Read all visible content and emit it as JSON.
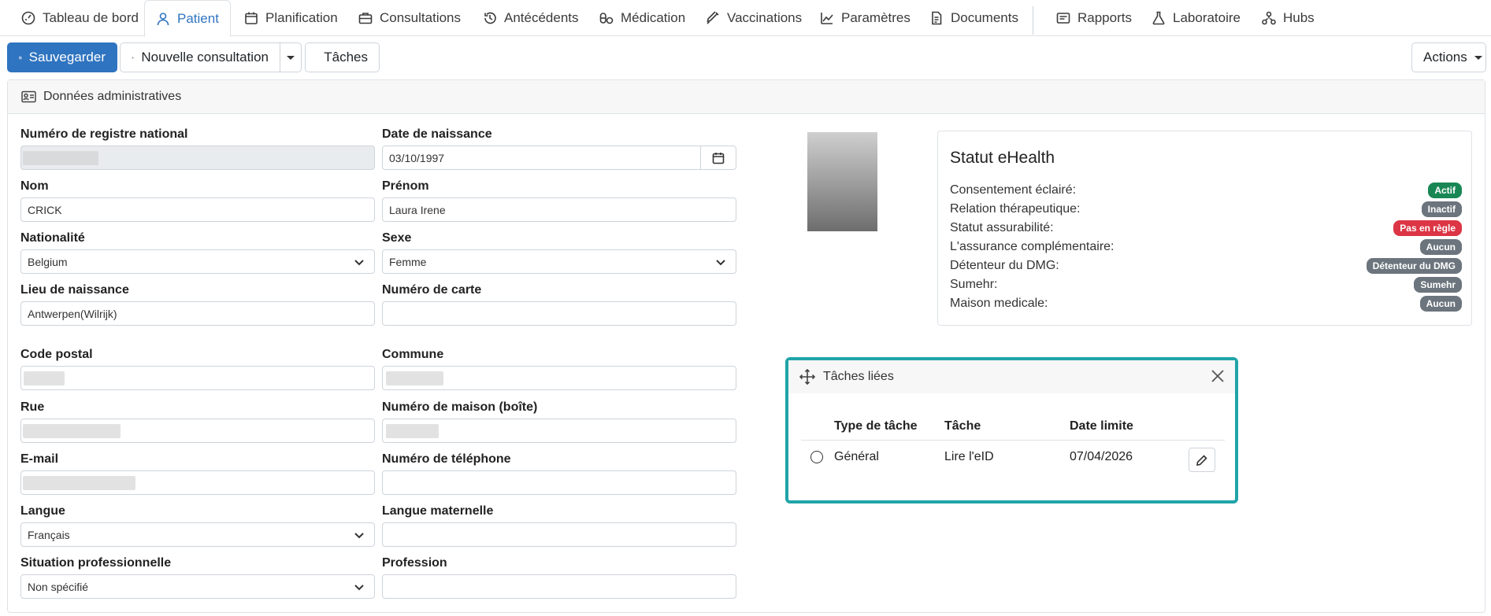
{
  "nav": {
    "items": [
      {
        "label": "Tableau de bord",
        "icon": "dashboard-icon"
      },
      {
        "label": "Patient",
        "icon": "person-icon",
        "active": true
      },
      {
        "label": "Planification",
        "icon": "calendar-icon"
      },
      {
        "label": "Consultations",
        "icon": "briefcase-icon"
      },
      {
        "label": "Antécédents",
        "icon": "history-icon"
      },
      {
        "label": "Médication",
        "icon": "pills-icon"
      },
      {
        "label": "Vaccinations",
        "icon": "syringe-icon"
      },
      {
        "label": "Paramètres",
        "icon": "chart-icon"
      },
      {
        "label": "Documents",
        "icon": "document-icon"
      },
      {
        "label": "Rapports",
        "icon": "report-icon"
      },
      {
        "label": "Laboratoire",
        "icon": "flask-icon"
      },
      {
        "label": "Hubs",
        "icon": "hubs-icon"
      }
    ]
  },
  "toolbar": {
    "save": "Sauvegarder",
    "new_consultation": "Nouvelle consultation",
    "tasks": "Tâches",
    "actions": "Actions"
  },
  "card": {
    "title": "Données administratives"
  },
  "form": {
    "national_number": {
      "label": "Numéro de registre national",
      "value": ""
    },
    "birth_date": {
      "label": "Date de naissance",
      "value": "03/10/1997"
    },
    "last_name": {
      "label": "Nom",
      "value": "CRICK"
    },
    "first_name": {
      "label": "Prénom",
      "value": "Laura Irene"
    },
    "nationality": {
      "label": "Nationalité",
      "value": "Belgium"
    },
    "sex": {
      "label": "Sexe",
      "value": "Femme"
    },
    "birth_place": {
      "label": "Lieu de naissance",
      "value": "Antwerpen(Wilrijk)"
    },
    "card_number": {
      "label": "Numéro de carte",
      "value": ""
    },
    "postal_code": {
      "label": "Code postal",
      "value": ""
    },
    "municipality": {
      "label": "Commune",
      "value": ""
    },
    "street": {
      "label": "Rue",
      "value": ""
    },
    "house_number": {
      "label": "Numéro de maison (boîte)",
      "value": ""
    },
    "email": {
      "label": "E-mail",
      "value": ""
    },
    "phone": {
      "label": "Numéro de téléphone",
      "value": ""
    },
    "language": {
      "label": "Langue",
      "value": "Français"
    },
    "mother_tongue": {
      "label": "Langue maternelle",
      "value": ""
    },
    "professional_situation": {
      "label": "Situation professionnelle",
      "value": "Non spécifié"
    },
    "profession": {
      "label": "Profession",
      "value": ""
    }
  },
  "ehealth": {
    "title": "Statut eHealth",
    "rows": [
      {
        "label": "Consentement éclairé:",
        "badge": "Actif",
        "color": "#198754"
      },
      {
        "label": "Relation thérapeutique:",
        "badge": "Inactif",
        "color": "#6c757d"
      },
      {
        "label": "Statut assurabilité:",
        "badge": "Pas en règle",
        "color": "#dc3545"
      },
      {
        "label": "L'assurance complémentaire:",
        "badge": "Aucun",
        "color": "#6c757d"
      },
      {
        "label": "Détenteur du DMG:",
        "badge": "Détenteur du DMG",
        "color": "#6c757d"
      },
      {
        "label": "Sumehr:",
        "badge": "Sumehr",
        "color": "#6c757d"
      },
      {
        "label": "Maison medicale:",
        "badge": "Aucun",
        "color": "#6c757d"
      }
    ]
  },
  "tasks_panel": {
    "title": "Tâches liées",
    "columns": [
      "Type de tâche",
      "Tâche",
      "Date limite"
    ],
    "rows": [
      {
        "type": "Général",
        "task": "Lire l'eID",
        "due": "07/04/2026"
      }
    ],
    "highlight_color": "#20a4a8"
  }
}
